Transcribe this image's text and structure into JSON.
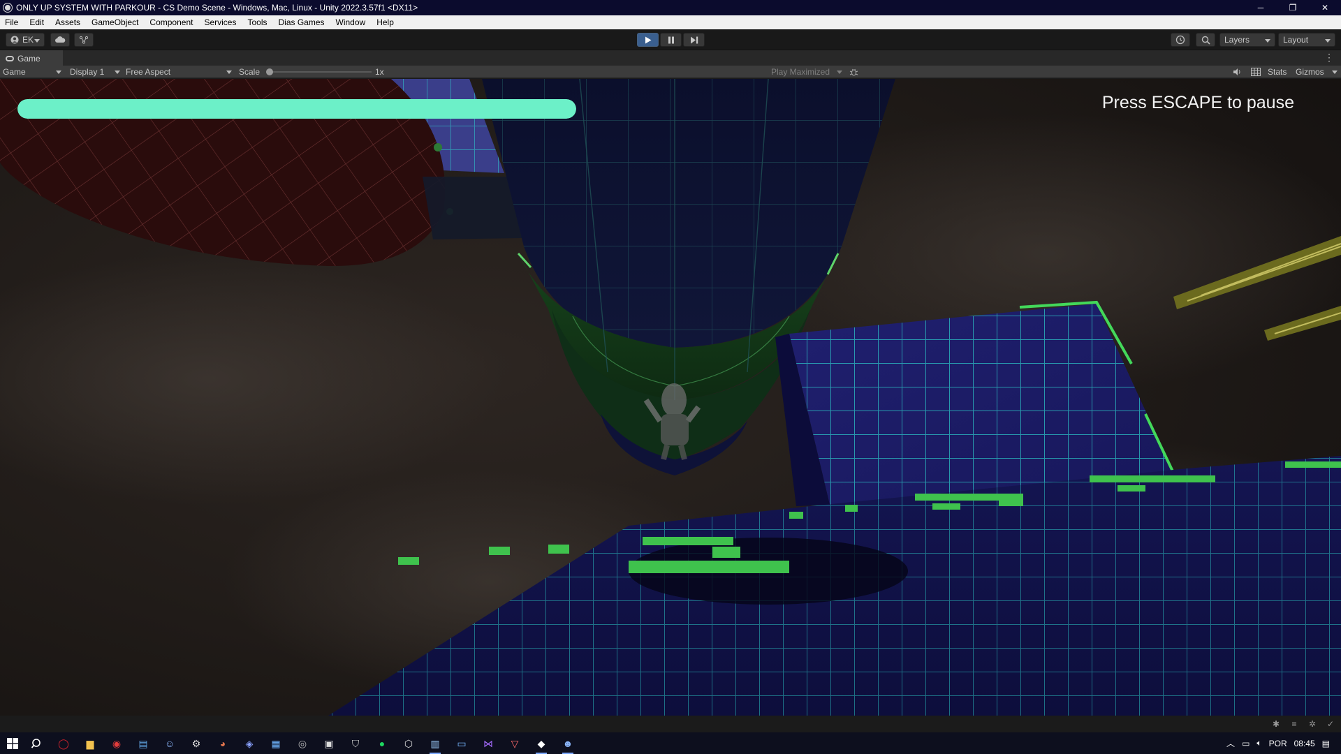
{
  "window": {
    "title": "ONLY UP SYSTEM WITH PARKOUR - CS Demo Scene - Windows, Mac, Linux - Unity 2022.3.57f1 <DX11>",
    "controls": {
      "minimize": "─",
      "restore": "❐",
      "close": "✕"
    }
  },
  "menubar": {
    "items": [
      "File",
      "Edit",
      "Assets",
      "GameObject",
      "Component",
      "Services",
      "Tools",
      "Dias Games",
      "Window",
      "Help"
    ]
  },
  "toolbar": {
    "account_label": "EK",
    "play_icon": "play-icon",
    "pause_icon": "pause-icon",
    "step_icon": "step-icon",
    "layers_label": "Layers",
    "layout_label": "Layout",
    "play_active_color": "#3a5f8f"
  },
  "tab": {
    "label": "Game"
  },
  "gamebar": {
    "view_select": "Game",
    "display_select": "Display 1",
    "aspect_select": "Free Aspect",
    "scale_label": "Scale",
    "scale_value": "1x",
    "play_mode_select": "Play Maximized",
    "stats_label": "Stats",
    "gizmos_label": "Gizmos"
  },
  "game": {
    "health_fraction": 1.0,
    "health_color": "#6cf0c8",
    "pause_hint": "Press ESCAPE to pause",
    "grid_color": "#2fe0d6",
    "edge_color": "#3ed35a"
  },
  "taskbar": {
    "language": "POR",
    "time": "08:45"
  }
}
